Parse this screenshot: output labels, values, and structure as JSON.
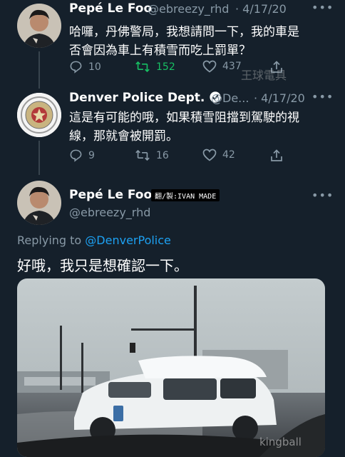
{
  "tweet1": {
    "display_name": "Pepé Le Foo",
    "handle": "@ebreezy_rhd",
    "date": "· 4/17/20",
    "text_line1": "哈囉，丹佛警局，我想請問一下，我的車是",
    "text_line2": "否會因為車上有積雪而吃上罰單？",
    "replies": "10",
    "retweets": "152",
    "likes": "437"
  },
  "watermark1": "王球電具",
  "tweet2": {
    "display_name": "Denver Police Dept.",
    "handle": "@De...",
    "date": "· 4/17/20",
    "text_line1": "這是有可能的哦，如果積雪阻擋到駕駛的視",
    "text_line2": "線，那就會被開罰。",
    "replies": "9",
    "retweets": "16",
    "likes": "42"
  },
  "tweet3": {
    "display_name": "Pepé Le Foo",
    "tag": "翻/製:IVAN MADE",
    "handle": "@ebreezy_rhd",
    "replying_prefix": "Replying to",
    "replying_to": "@DenverPolice",
    "text": "好哦，我只是想確認一下。"
  },
  "watermark2": "kingball",
  "colors": {
    "background": "#15202b",
    "muted": "#8899a6",
    "link": "#1da1f2",
    "retweet_green": "#17bf63"
  },
  "icons": [
    "reply-icon",
    "retweet-icon",
    "like-icon",
    "share-icon",
    "more-icon",
    "verified-icon"
  ]
}
